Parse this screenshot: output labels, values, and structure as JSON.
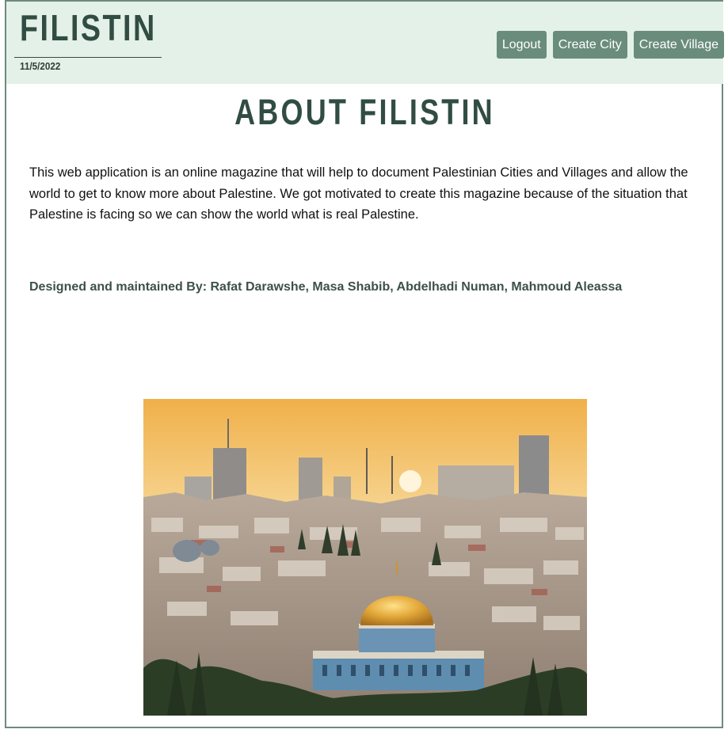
{
  "header": {
    "logo": "FILISTIN",
    "date": "11/5/2022",
    "nav": [
      "Logout",
      "Create City",
      "Create Village"
    ]
  },
  "main": {
    "title": "ABOUT FILISTIN",
    "description": "This web application is an online magazine that will help to document Palestinian Cities and Villages and allow the world to get to know more about Palestine. We got motivated to create this magazine because of the situation that Palestine is facing so we can show the world what is real Palestine.",
    "credits": "Designed and maintained By: Rafat Darawshe, Masa Shabib, Abdelhadi Numan, Mahmoud Aleassa"
  },
  "colors": {
    "header_bg": "#e4f1e8",
    "accent": "#6a8c7d",
    "heading": "#314d43"
  },
  "image": {
    "subject": "jerusalem-skyline-with-dome-of-the-rock"
  }
}
